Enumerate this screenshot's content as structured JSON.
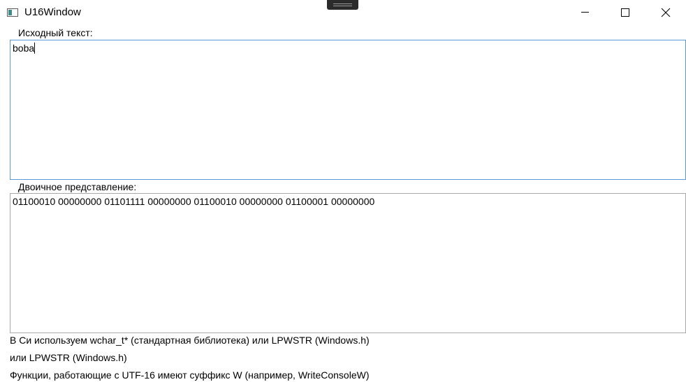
{
  "window": {
    "title": "U16Window",
    "icon": "app-window-icon"
  },
  "source": {
    "label": "Исходный текст:",
    "value": "boba"
  },
  "binary": {
    "label": "Двоичное представление:",
    "value": "01100010 00000000 01101111 00000000 01100010 00000000 01100001 00000000"
  },
  "info": {
    "line1": "В Си используем wchar_t* (стандартная библиотека) или LPWSTR (Windows.h)",
    "line2": "или LPWSTR (Windows.h)",
    "line3": "Функции, работающие с UTF-16 имеют суффикс W (например, WriteConsoleW)"
  },
  "colors": {
    "focus_border": "#5b9bd5",
    "border": "#a9a9a9"
  }
}
